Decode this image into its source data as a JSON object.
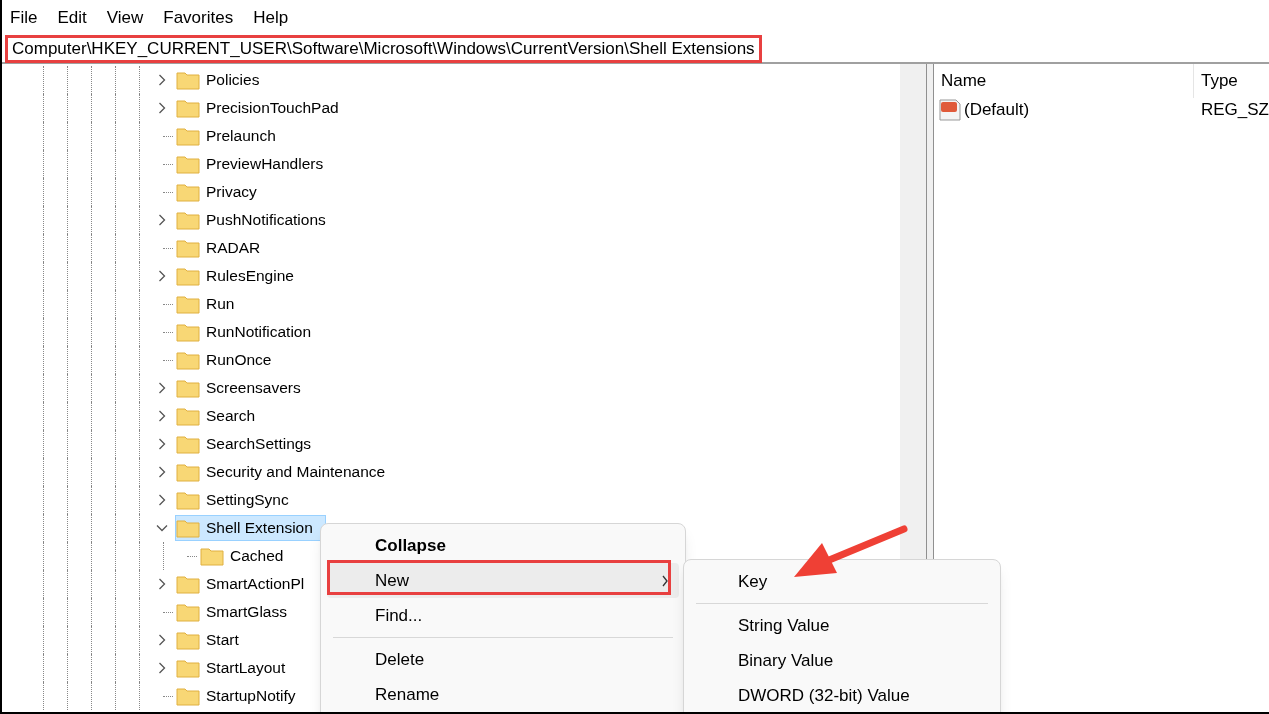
{
  "menu_bar": [
    "File",
    "Edit",
    "View",
    "Favorites",
    "Help"
  ],
  "address_bar": {
    "value": "Computer\\HKEY_CURRENT_USER\\Software\\Microsoft\\Windows\\CurrentVersion\\Shell Extensions"
  },
  "tree": {
    "items": [
      {
        "label": "Policies",
        "expanded": false,
        "selected": false
      },
      {
        "label": "PrecisionTouchPad",
        "expanded": false,
        "selected": false
      },
      {
        "label": "Prelaunch",
        "selected": false
      },
      {
        "label": "PreviewHandlers",
        "selected": false
      },
      {
        "label": "Privacy",
        "selected": false
      },
      {
        "label": "PushNotifications",
        "expanded": false,
        "selected": false
      },
      {
        "label": "RADAR",
        "selected": false
      },
      {
        "label": "RulesEngine",
        "expanded": false,
        "selected": false
      },
      {
        "label": "Run",
        "selected": false
      },
      {
        "label": "RunNotification",
        "selected": false
      },
      {
        "label": "RunOnce",
        "selected": false
      },
      {
        "label": "Screensavers",
        "expanded": false,
        "selected": false
      },
      {
        "label": "Search",
        "expanded": false,
        "selected": false
      },
      {
        "label": "SearchSettings",
        "expanded": false,
        "selected": false
      },
      {
        "label": "Security and Maintenance",
        "expanded": false,
        "selected": false
      },
      {
        "label": "SettingSync",
        "expanded": false,
        "selected": false
      },
      {
        "label": "Shell Extension",
        "expanded": true,
        "selected": true,
        "children": [
          {
            "label": "Cached",
            "selected": false
          }
        ]
      },
      {
        "label": "SmartActionPl",
        "expanded": false,
        "selected": false
      },
      {
        "label": "SmartGlass",
        "selected": false
      },
      {
        "label": "Start",
        "expanded": false,
        "selected": false
      },
      {
        "label": "StartLayout",
        "expanded": false,
        "selected": false
      },
      {
        "label": "StartupNotify",
        "selected": false
      }
    ]
  },
  "values_list": {
    "columns": [
      "Name",
      "Type"
    ],
    "rows": [
      {
        "name": "(Default)",
        "type": "REG_SZ"
      }
    ]
  },
  "context_menu": {
    "items": [
      {
        "kind": "default",
        "label": "Collapse",
        "selected": false
      },
      {
        "kind": "submenu",
        "label": "New",
        "selected": true
      },
      {
        "kind": "item",
        "label": "Find...",
        "selected": false
      },
      {
        "kind": "separator"
      },
      {
        "kind": "item",
        "label": "Delete",
        "selected": false
      },
      {
        "kind": "item",
        "label": "Rename",
        "selected": false
      }
    ]
  },
  "submenu": {
    "items": [
      {
        "kind": "item",
        "label": "Key",
        "selected": false
      },
      {
        "kind": "separator"
      },
      {
        "kind": "item",
        "label": "String Value",
        "selected": false
      },
      {
        "kind": "item",
        "label": "Binary Value",
        "selected": false
      },
      {
        "kind": "item",
        "label": "DWORD (32-bit) Value",
        "selected": false
      }
    ]
  }
}
